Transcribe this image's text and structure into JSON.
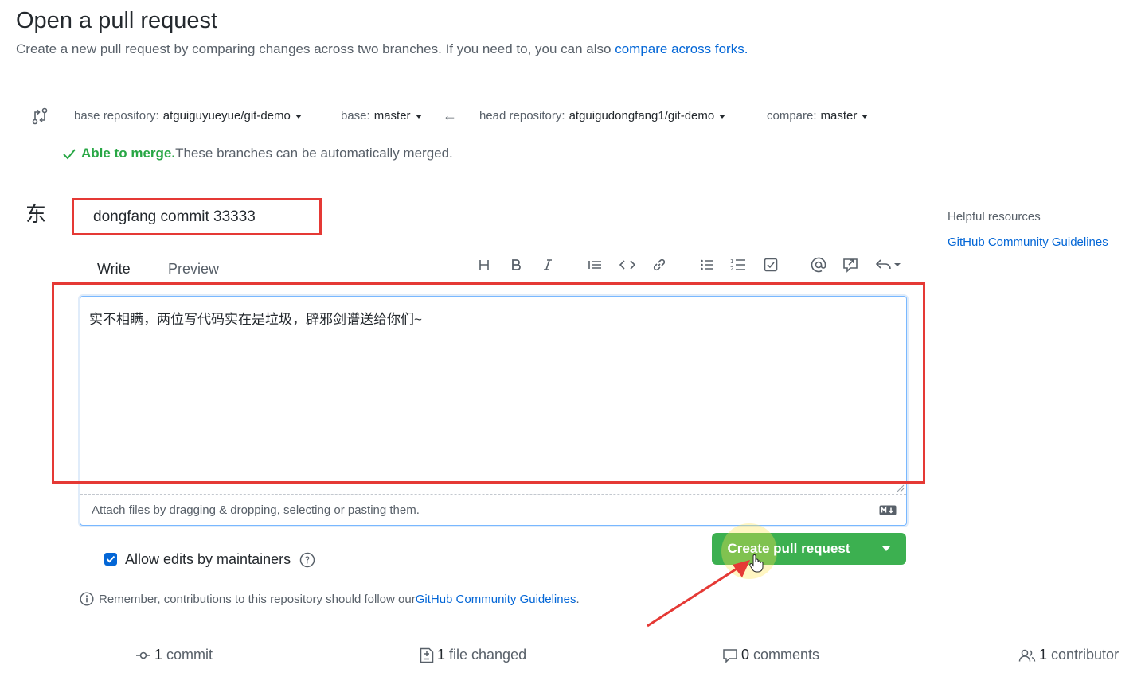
{
  "page": {
    "title": "Open a pull request",
    "subtitle": "Create a new pull request by comparing changes across two branches. If you need to, you can also ",
    "subtitle_link": "compare across forks."
  },
  "compare": {
    "base_repo_label": "base repository:",
    "base_repo_value": "atguiguyueyue/git-demo",
    "base_label": "base:",
    "base_value": "master",
    "head_repo_label": "head repository:",
    "head_repo_value": "atguigudongfang1/git-demo",
    "compare_label": "compare:",
    "compare_value": "master",
    "arrow": "←"
  },
  "merge": {
    "ok_text": "Able to merge.",
    "detail": " These branches can be automatically merged."
  },
  "avatar": {
    "char": "东"
  },
  "form": {
    "title_value": "dongfang commit 33333",
    "tabs": [
      {
        "label": "Write"
      },
      {
        "label": "Preview"
      }
    ],
    "body_text": "实不相瞒，两位写代码实在是垃圾，辟邪剑谱送给你们~",
    "attach_hint": "Attach files by dragging & dropping, selecting or pasting them.",
    "allow_edits_label": "Allow edits by maintainers",
    "create_button": "Create pull request",
    "remember_text": "Remember, contributions to this repository should follow our ",
    "remember_link": "GitHub Community Guidelines",
    "remember_end": "."
  },
  "stats": {
    "commits_count": "1",
    "commits_label": "commit",
    "files_count": "1",
    "files_label": "file changed",
    "comments_count": "0",
    "comments_label": "comments",
    "contributors_count": "1",
    "contributors_label": "contributor"
  },
  "sidebar": {
    "heading": "Helpful resources",
    "link": "GitHub Community Guidelines"
  },
  "colors": {
    "accent": "#0366d6",
    "success": "#28a745",
    "button": "#3cb050",
    "annotation": "#e53935"
  },
  "icons": [
    "compare-icon",
    "check-icon",
    "heading-icon",
    "bold-icon",
    "italic-icon",
    "quote-icon",
    "code-icon",
    "link-icon",
    "bulleted-list-icon",
    "numbered-list-icon",
    "task-list-icon",
    "mention-icon",
    "reference-icon",
    "reply-icon",
    "markdown-icon",
    "help-icon",
    "info-icon",
    "commit-icon",
    "file-diff-icon",
    "comment-icon",
    "people-icon",
    "cursor-hand-icon"
  ]
}
